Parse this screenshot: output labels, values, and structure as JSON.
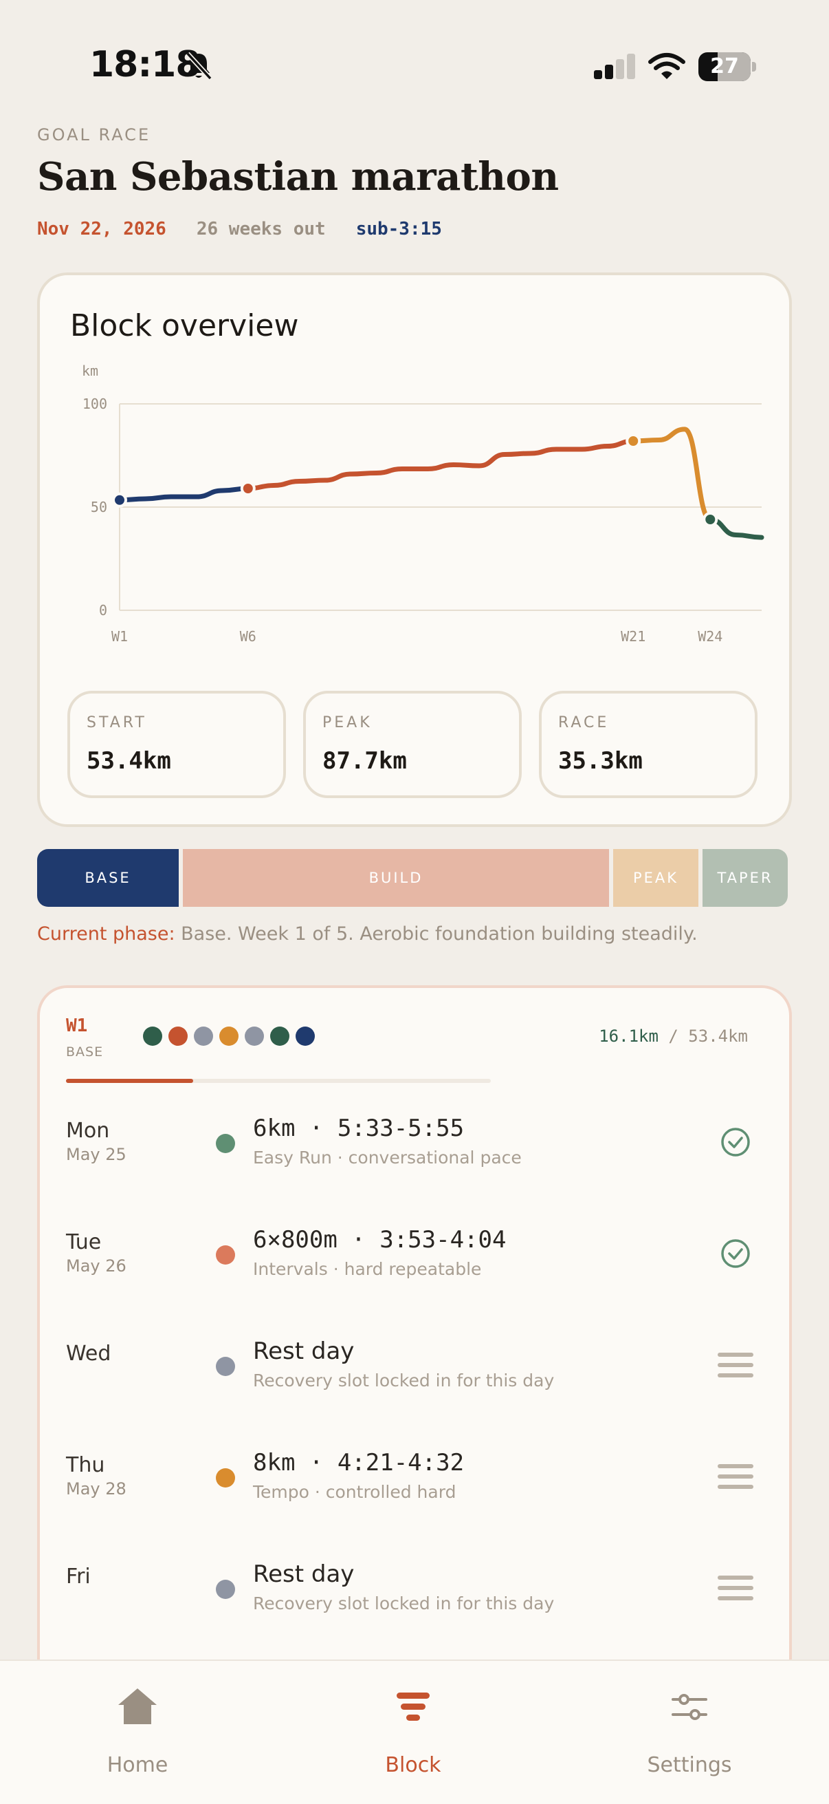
{
  "status_bar": {
    "time": "18:18",
    "battery": "27"
  },
  "header": {
    "goal_label": "GOAL RACE",
    "race_name": "San Sebastian marathon",
    "date": "Nov 22, 2026",
    "weeks_out": "26 weeks out",
    "target": "sub-3:15"
  },
  "overview": {
    "title": "Block overview",
    "stats": [
      {
        "label": "START",
        "value": "53.4km"
      },
      {
        "label": "PEAK",
        "value": "87.7km"
      },
      {
        "label": "RACE",
        "value": "35.3km"
      }
    ]
  },
  "chart_data": {
    "type": "line",
    "title": "Block overview",
    "ylabel": "km",
    "xlabel": "",
    "ylim": [
      0,
      100
    ],
    "yticks": [
      0,
      50,
      100
    ],
    "xtick_labels": [
      "W1",
      "W6",
      "W21",
      "W24"
    ],
    "grid": true,
    "series": [
      {
        "name": "BASE",
        "color": "#1f3a6e",
        "x": [
          1,
          2,
          3,
          4,
          5,
          6
        ],
        "y": [
          53.4,
          54.0,
          55.0,
          55.0,
          58.0,
          59.0
        ]
      },
      {
        "name": "BUILD",
        "color": "#c5532f",
        "x": [
          6,
          7,
          8,
          9,
          10,
          11,
          12,
          13,
          14,
          15,
          16,
          17,
          18,
          19,
          20,
          21
        ],
        "y": [
          59.0,
          60.5,
          62.5,
          63.0,
          66.0,
          66.5,
          68.5,
          68.5,
          70.5,
          70.0,
          75.5,
          76.0,
          78.0,
          78.0,
          79.5,
          82.0
        ]
      },
      {
        "name": "PEAK",
        "color": "#d98c2e",
        "x": [
          21,
          22,
          23,
          24
        ],
        "y": [
          82.0,
          82.5,
          87.7,
          44.0
        ]
      },
      {
        "name": "TAPER",
        "color": "#2f5e4a",
        "x": [
          24,
          25,
          26
        ],
        "y": [
          44.0,
          36.5,
          35.3
        ]
      }
    ],
    "markers": [
      {
        "x": 1,
        "y": 53.4,
        "color": "#1f3a6e"
      },
      {
        "x": 6,
        "y": 59.0,
        "color": "#c5532f"
      },
      {
        "x": 21,
        "y": 82.0,
        "color": "#d98c2e"
      },
      {
        "x": 24,
        "y": 44.0,
        "color": "#2f5e4a"
      }
    ]
  },
  "phases": [
    "BASE",
    "BUILD",
    "PEAK",
    "TAPER"
  ],
  "current_phase": {
    "label": "Current phase:",
    "text": " Base. Week 1 of 5. Aerobic foundation building steadily."
  },
  "week": {
    "label": "W1",
    "phase": "BASE",
    "done_km": "16.1km",
    "separator": " / ",
    "total_km": "53.4km",
    "progress": 0.3,
    "dots": [
      "#2f5e4a",
      "#c5532f",
      "#8f95a3",
      "#d98c2e",
      "#8f95a3",
      "#2f5e4a",
      "#1f3a6e"
    ],
    "days": [
      {
        "day": "Mon",
        "date": "May 25",
        "title": "6km · 5:33-5:55",
        "subtitle": "Easy Run · conversational pace",
        "color": "#5f8f73",
        "status": "done"
      },
      {
        "day": "Tue",
        "date": "May 26",
        "title": "6×800m · 3:53-4:04",
        "subtitle": "Intervals · hard repeatable",
        "color": "#db7a5c",
        "status": "done"
      },
      {
        "day": "Wed",
        "date": "",
        "title": "Rest day",
        "subtitle": "Recovery slot locked in for this day",
        "color": "#8f95a3",
        "status": "pending"
      },
      {
        "day": "Thu",
        "date": "May 28",
        "title": "8km · 4:21-4:32",
        "subtitle": "Tempo · controlled hard",
        "color": "#d98c2e",
        "status": "pending"
      },
      {
        "day": "Fri",
        "date": "",
        "title": "Rest day",
        "subtitle": "Recovery slot locked in for this day",
        "color": "#8f95a3",
        "status": "pending"
      }
    ]
  },
  "tabs": [
    {
      "label": "Home",
      "icon": "home-icon"
    },
    {
      "label": "Block",
      "icon": "block-icon"
    },
    {
      "label": "Settings",
      "icon": "sliders-icon"
    }
  ]
}
